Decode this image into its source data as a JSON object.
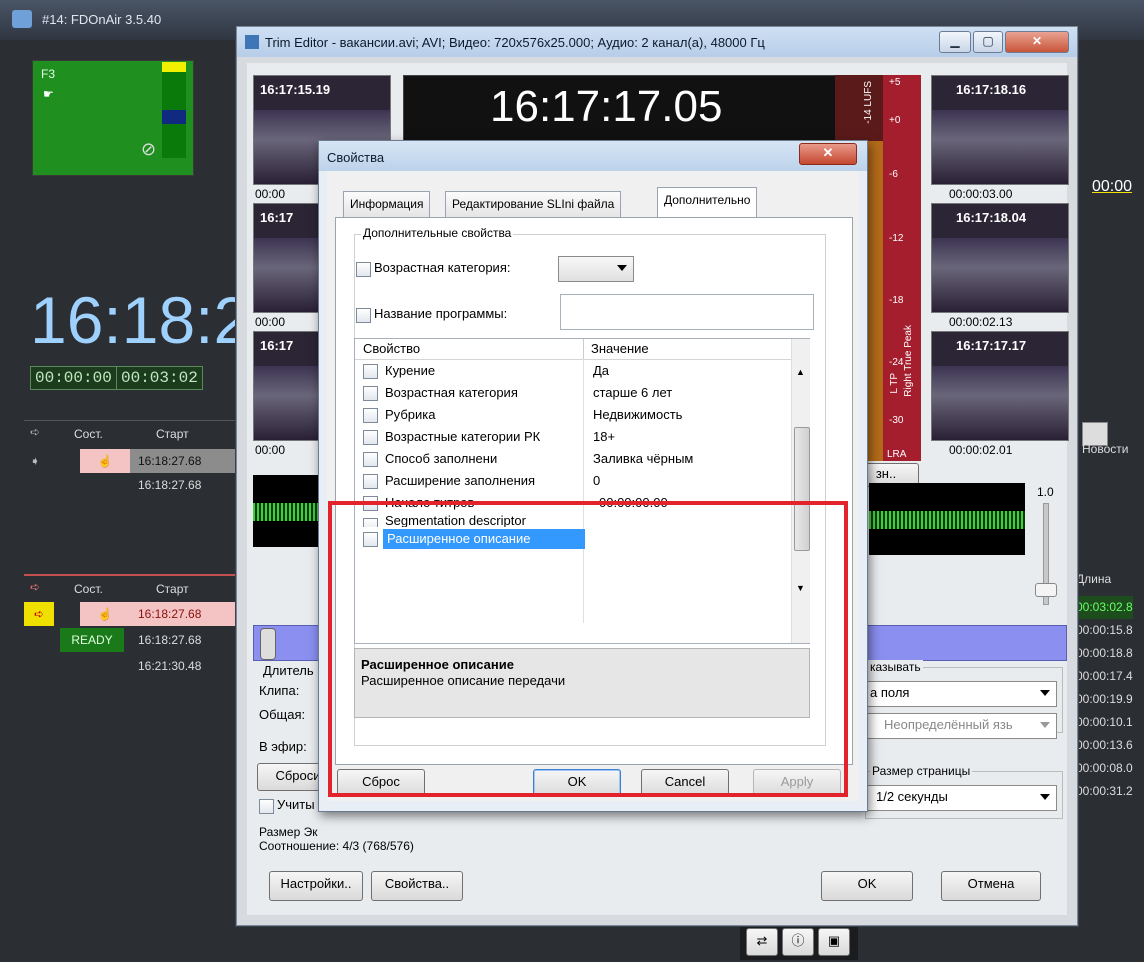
{
  "app": {
    "title": "#14: FDOnAir 3.5.40",
    "f3_label": "F3",
    "big_clock": "16:18:2",
    "tc_a": "00:00:00",
    "tc_b": "00:03:02",
    "grid1": {
      "headers": [
        "Сост.",
        "Старт"
      ],
      "rows": [
        {
          "start": "16:18:27.68"
        },
        {
          "start": "16:18:27.68"
        }
      ]
    },
    "grid2": {
      "headers": [
        "Сост.",
        "Старт"
      ],
      "rows": [
        {
          "state": "",
          "start": "16:18:27.68"
        },
        {
          "state": "READY",
          "start": "16:18:27.68"
        },
        {
          "state": "",
          "start": "16:21:30.48"
        }
      ]
    },
    "right_tc": "00:00",
    "news_label": "Новости",
    "length_header": "Длина",
    "lengths": [
      "00:03:02.8",
      "00:00:15.8",
      "00:00:18.8",
      "00:00:17.4",
      "00:00:19.9",
      "00:00:10.1",
      "00:00:13.6",
      "00:00:08.0",
      "00:00:31.2"
    ]
  },
  "trim": {
    "title": "Trim Editor - вакансии.avi; AVI; Видео: 720x576x25.000; Аудио: 2 канал(а), 48000 Гц",
    "main_tc": "16:17:17.05",
    "left_thumbs": [
      {
        "tc": "16:17:15.19",
        "under": "00:00"
      },
      {
        "tc": "16:17",
        "under": "00:00"
      },
      {
        "tc": "16:17",
        "under": "00:00"
      }
    ],
    "right_thumbs": [
      {
        "tc": "16:17:18.16",
        "under": "00:00:03.00"
      },
      {
        "tc": "16:17:18.04",
        "under": "00:00:02.13"
      },
      {
        "tc": "16:17:17.17",
        "under": "00:00:02.01"
      }
    ],
    "meter": {
      "lufs": "-14 LUFS",
      "right_peak": "Right True Peak",
      "lra": "LRA",
      "ltp": "L TP"
    },
    "meter_scale": [
      "+5",
      "+0",
      "-6",
      "-12",
      "-18",
      "-24",
      "-30"
    ],
    "vol_label": "1.0",
    "btn_small": "зн..",
    "duration_label": "Длитель",
    "clip_label": "Клипа:",
    "total_label": "Общая:",
    "onair_label": "В эфир:",
    "reset_left": "Сброси",
    "consider_label": "Учиты",
    "size_label": "Размер Эк",
    "ratio_label": "Соотношение: 4/3 (768/576)",
    "show_label": "казывать",
    "field_dd": "а поля",
    "lang_dd": "Неопределённый язь",
    "page_size_label": "Размер страницы",
    "page_size_dd": "1/2 секунды",
    "settings_btn": "Настройки..",
    "props_btn": "Свойства..",
    "ok_btn": "OK",
    "cancel_btn": "Отмена"
  },
  "props": {
    "title": "Свойства",
    "tabs": [
      "Информация",
      "Редактирование SLIni файла",
      "Дополнительно"
    ],
    "group_label": "Дополнительные свойства",
    "age_cat_label": "Возрастная категория:",
    "program_name_label": "Название программы:",
    "table_headers": [
      "Свойство",
      "Значение"
    ],
    "rows": [
      {
        "name": "Курение",
        "value": "Да"
      },
      {
        "name": "Возрастная категория",
        "value": "старше 6 лет"
      },
      {
        "name": "Рубрика",
        "value": "Недвижимость"
      },
      {
        "name": "Возрастные категории РК",
        "value": "18+"
      },
      {
        "name": "Способ заполнени",
        "value": "Заливка чёрным"
      },
      {
        "name": "Расширение заполнения",
        "value": "0"
      },
      {
        "name": "Начало титров",
        "value": "00:00:00.00"
      },
      {
        "name": "Segmentation descriptor",
        "value": ""
      },
      {
        "name": "Расширенное описание",
        "value": ""
      }
    ],
    "desc_title": "Расширенное описание",
    "desc_text": "Расширенное описание передачи",
    "buttons": {
      "reset": "Сброс",
      "ok": "OK",
      "cancel": "Cancel",
      "apply": "Apply"
    },
    "colors": {
      "highlight": "#e2232b",
      "selected": "#3399ff"
    }
  }
}
